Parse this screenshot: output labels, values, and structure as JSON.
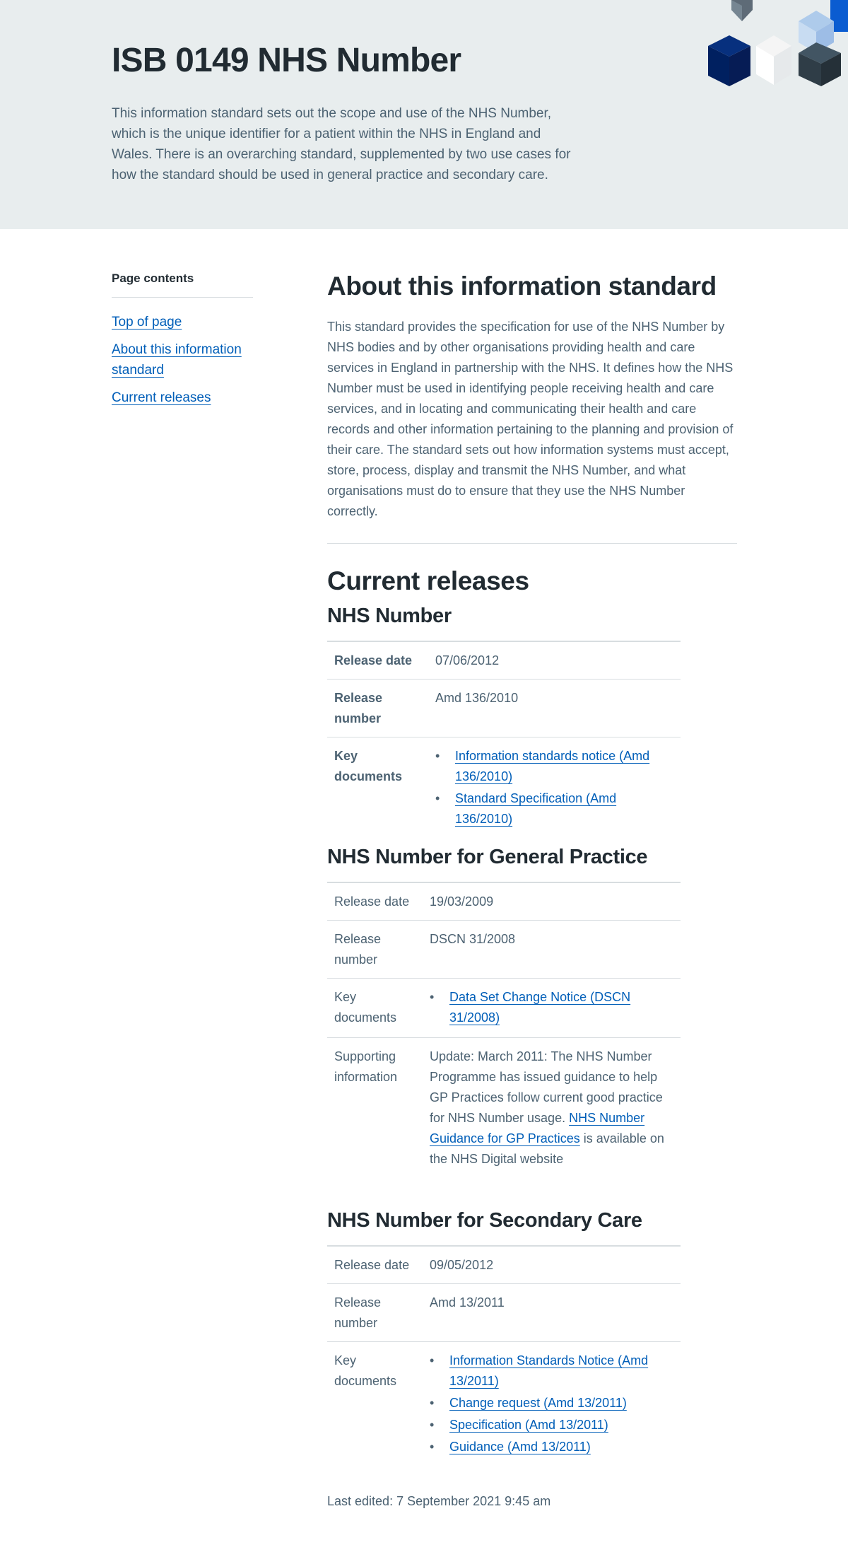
{
  "hero": {
    "title": "ISB 0149 NHS Number",
    "description": "This information standard sets out the scope and use of the NHS Number, which is the unique identifier for a patient within the NHS in England and Wales. There is an overarching standard, supplemented by two use cases for how the standard should be used in general practice and secondary care."
  },
  "sidebar": {
    "heading": "Page contents",
    "links": [
      "Top of page",
      "About this information standard",
      "Current releases"
    ]
  },
  "about": {
    "heading": "About this information standard",
    "body": "This standard provides the specification for use of the NHS Number by NHS bodies and by other organisations providing health and care services in England in partnership with the NHS. It defines how the NHS Number must be used in identifying people receiving health and care services, and in locating and communicating their health and care records and other information pertaining to the planning and provision of their care. The standard sets out how information systems must accept, store, process, display and transmit the NHS Number, and what organisations must do to ensure that they use the NHS Number correctly."
  },
  "releases": {
    "heading": "Current releases",
    "nhs_number": {
      "title": "NHS Number",
      "release_date_label": "Release date",
      "release_date": "07/06/2012",
      "release_number_label": "Release number",
      "release_number": "Amd 136/2010",
      "key_documents_label": "Key documents",
      "documents": [
        "Information standards notice (Amd 136/2010)",
        "Standard Specification (Amd 136/2010)"
      ]
    },
    "general_practice": {
      "title": "NHS Number for General Practice",
      "release_date_label": "Release date",
      "release_date": "19/03/2009",
      "release_number_label": "Release number",
      "release_number": "DSCN 31/2008",
      "key_documents_label": "Key documents",
      "documents": [
        "Data Set Change Notice (DSCN 31/2008)"
      ],
      "supporting_label": "Supporting information",
      "supporting_before": "Update: March 2011: The NHS Number Programme has issued guidance to help GP Practices follow current good practice for NHS Number usage.",
      "supporting_link": "NHS Number Guidance for GP Practices",
      "supporting_after": "is available on the NHS Digital website"
    },
    "secondary_care": {
      "title": "NHS Number for Secondary Care",
      "release_date_label": "Release date",
      "release_date": "09/05/2012",
      "release_number_label": "Release number",
      "release_number": "Amd 13/2011",
      "key_documents_label": "Key documents",
      "documents": [
        "Information Standards Notice (Amd 13/2011)",
        "Change request (Amd 13/2011)",
        "Specification (Amd 13/2011)",
        "Guidance (Amd 13/2011)"
      ]
    }
  },
  "footer": {
    "last_edited": "Last edited: 7 September 2021 9:45 am"
  },
  "colors": {
    "hero_bg": "#e8edee",
    "link": "#005eb8",
    "text": "#212b32",
    "secondary_text": "#4c6272",
    "border": "#d8dde0"
  }
}
